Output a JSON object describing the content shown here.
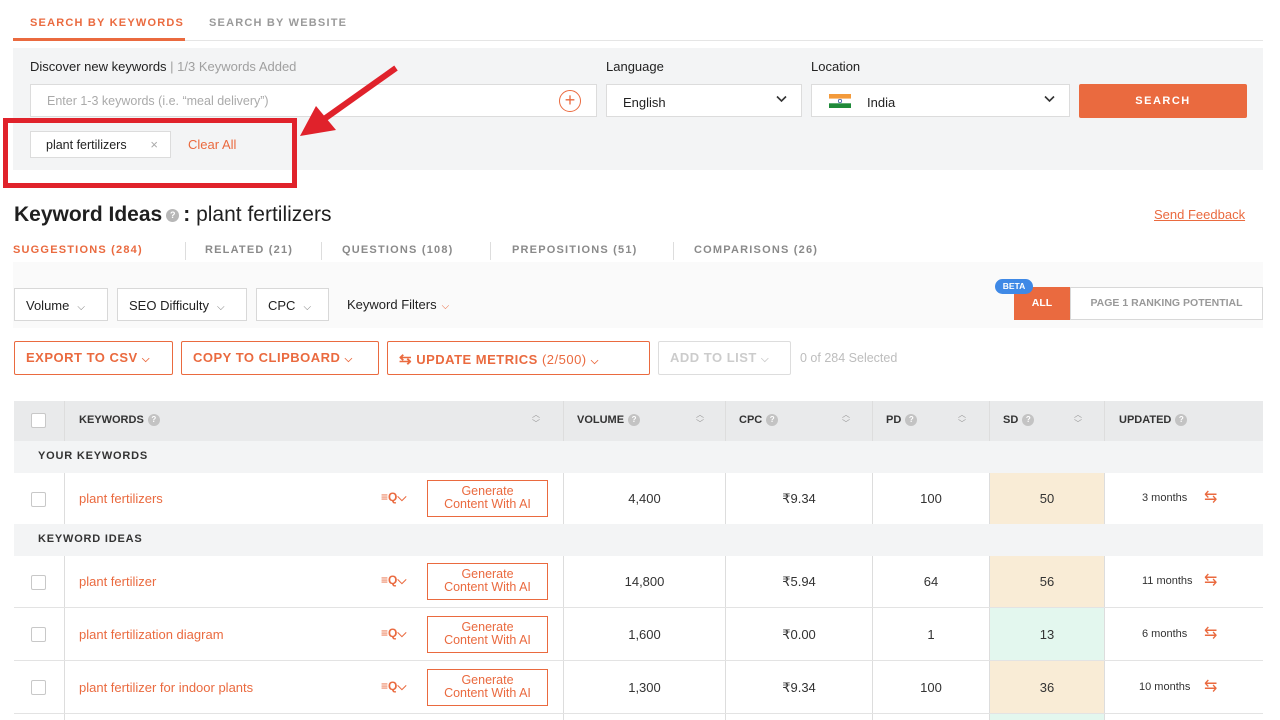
{
  "top_tabs": [
    {
      "label": "SEARCH BY KEYWORDS",
      "active": true
    },
    {
      "label": "SEARCH BY WEBSITE",
      "active": false
    }
  ],
  "search": {
    "discover_label": "Discover new keywords",
    "added_label": "| 1/3 Keywords Added",
    "placeholder": "Enter 1-3 keywords (i.e. “meal delivery”)",
    "language_label": "Language",
    "language_value": "English",
    "location_label": "Location",
    "location_value": "India",
    "search_button": "SEARCH",
    "chip": "plant fertilizers",
    "clear_all": "Clear All"
  },
  "heading": {
    "title": "Keyword Ideas",
    "separator": ":",
    "keyword": "plant fertilizers",
    "feedback": "Send Feedback"
  },
  "sub_tabs": [
    {
      "label": "SUGGESTIONS (284)",
      "active": true
    },
    {
      "label": "RELATED (21)",
      "active": false
    },
    {
      "label": "QUESTIONS (108)",
      "active": false
    },
    {
      "label": "PREPOSITIONS (51)",
      "active": false
    },
    {
      "label": "COMPARISONS (26)",
      "active": false
    }
  ],
  "filters": {
    "volume": "Volume",
    "seo_difficulty": "SEO Difficulty",
    "cpc": "CPC",
    "keyword_filters": "Keyword Filters",
    "beta": "BETA",
    "all": "ALL",
    "page1": "PAGE 1 RANKING POTENTIAL"
  },
  "actions": {
    "export": "EXPORT TO CSV",
    "copy": "COPY TO CLIPBOARD",
    "update": "UPDATE METRICS",
    "update_count": "(2/500)",
    "add": "ADD TO LIST",
    "selected": "0 of 284 Selected"
  },
  "table": {
    "headers": {
      "keywords": "KEYWORDS",
      "volume": "VOLUME",
      "cpc": "CPC",
      "pd": "PD",
      "sd": "SD",
      "updated": "UPDATED"
    },
    "section_your": "YOUR KEYWORDS",
    "section_ideas": "KEYWORD IDEAS",
    "generate_label_1": "Generate",
    "generate_label_2": "Content With AI",
    "rows": [
      {
        "keyword": "plant fertilizers",
        "volume": "4,400",
        "cpc": "₹9.34",
        "pd": "100",
        "sd": "50",
        "sd_color": "#f9ecd6",
        "updated": "3 months"
      },
      {
        "keyword": "plant fertilizer",
        "volume": "14,800",
        "cpc": "₹5.94",
        "pd": "64",
        "sd": "56",
        "sd_color": "#f9ecd6",
        "updated": "11 months"
      },
      {
        "keyword": "plant fertilization diagram",
        "volume": "1,600",
        "cpc": "₹0.00",
        "pd": "1",
        "sd": "13",
        "sd_color": "#e3f7ee",
        "updated": "6 months"
      },
      {
        "keyword": "plant fertilizer for indoor plants",
        "volume": "1,300",
        "cpc": "₹9.34",
        "pd": "100",
        "sd": "36",
        "sd_color": "#f9ecd6",
        "updated": "10 months"
      }
    ]
  },
  "colors": {
    "accent": "#ea6a3f",
    "annotation": "#e0222b"
  }
}
